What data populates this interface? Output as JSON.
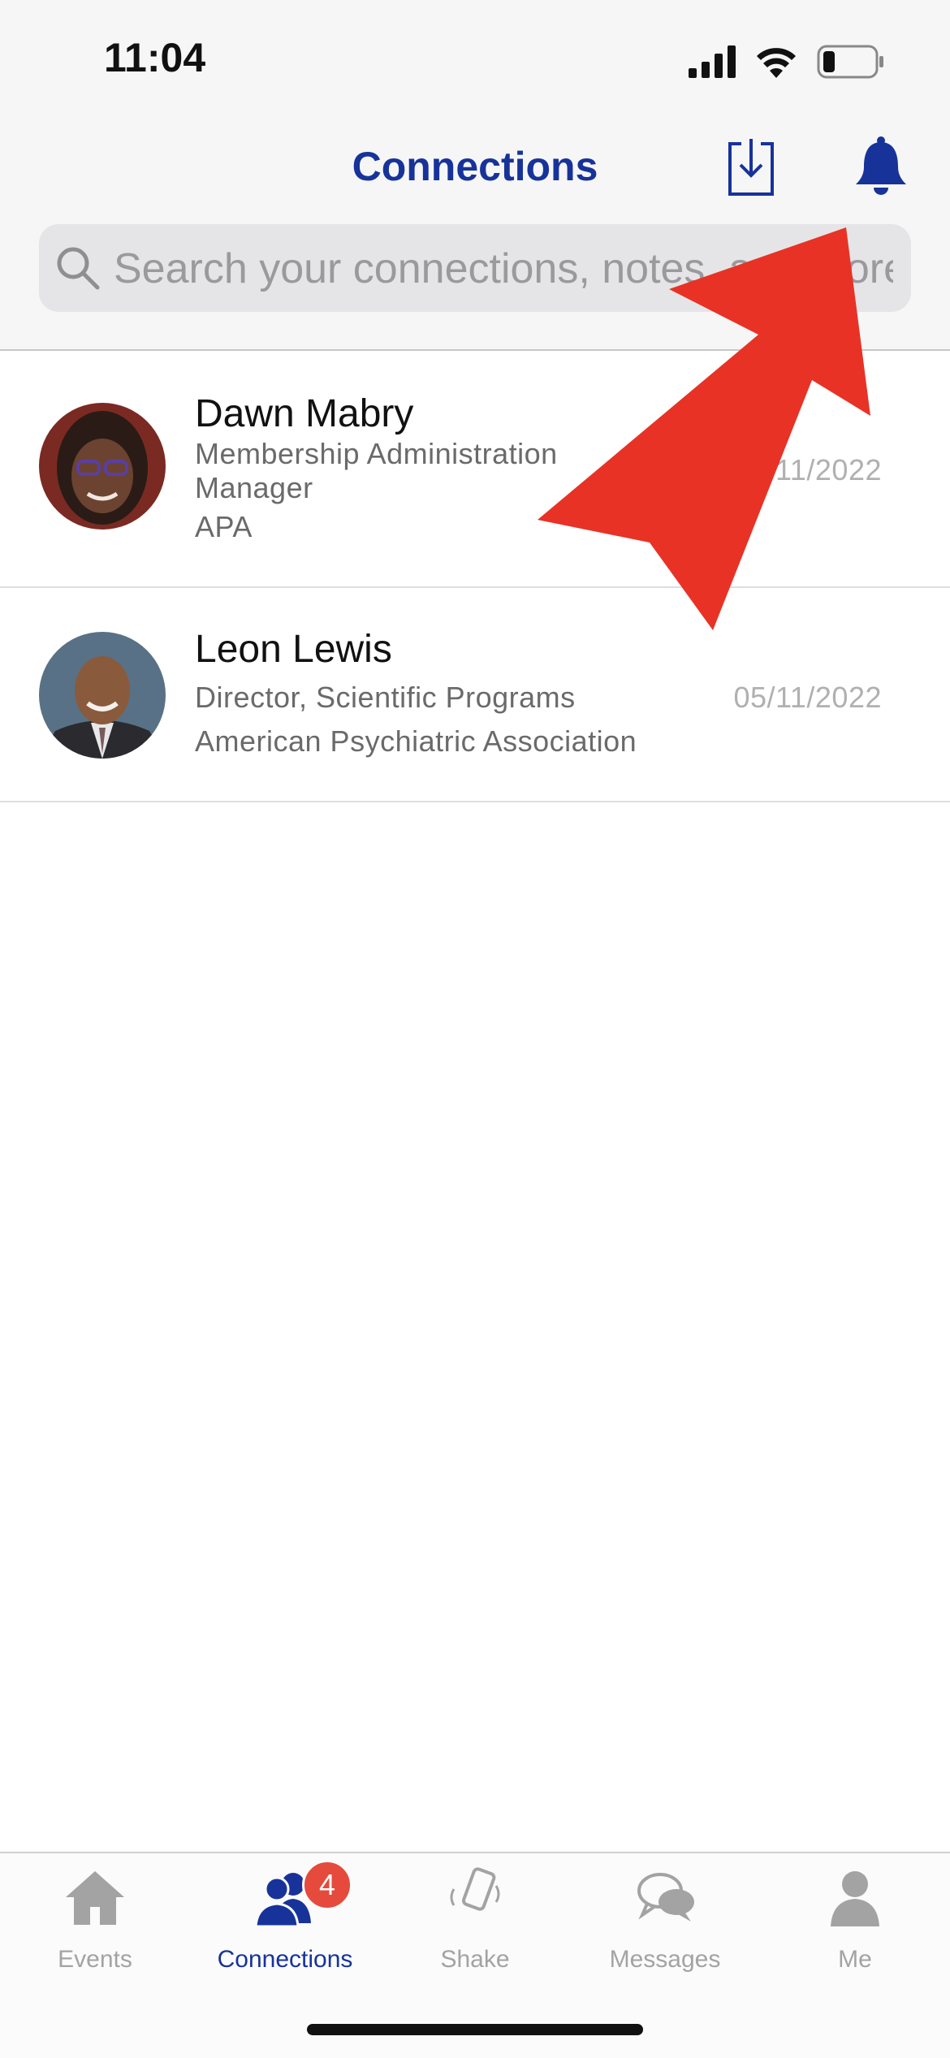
{
  "status_bar": {
    "time": "11:04"
  },
  "header": {
    "title": "Connections",
    "export_icon": "download-icon",
    "notifications_icon": "bell-icon"
  },
  "search": {
    "placeholder": "Search your connections, notes, and more"
  },
  "connections": [
    {
      "name": "Dawn Mabry",
      "title_line1": "Membership Administration",
      "title_line2": "Manager",
      "organization": "APA",
      "date": "05/11/2022",
      "date_visible": "11/2022"
    },
    {
      "name": "Leon Lewis",
      "title": "Director, Scientific Programs",
      "organization": "American Psychiatric Association",
      "date": "05/11/2022"
    }
  ],
  "tabs": [
    {
      "label": "Events",
      "icon": "home-icon"
    },
    {
      "label": "Connections",
      "icon": "people-icon",
      "badge": "4",
      "active": true
    },
    {
      "label": "Shake",
      "icon": "shake-phone-icon"
    },
    {
      "label": "Messages",
      "icon": "chat-bubbles-icon"
    },
    {
      "label": "Me",
      "icon": "person-icon"
    }
  ],
  "colors": {
    "brand": "#17339a",
    "badge": "#e54a3c",
    "annotation_arrow": "#e83225"
  }
}
